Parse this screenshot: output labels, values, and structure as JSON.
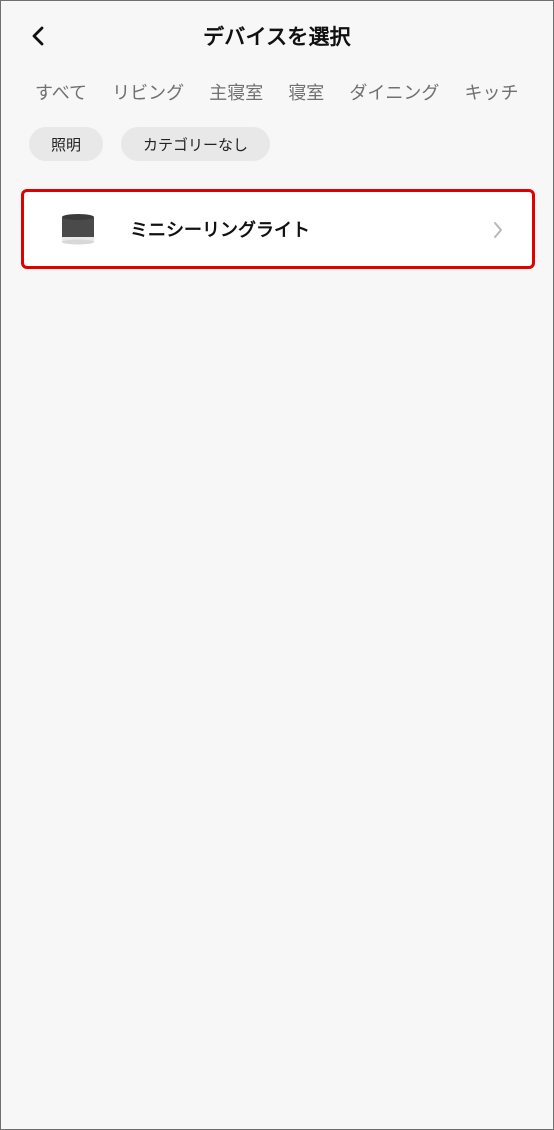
{
  "header": {
    "title": "デバイスを選択"
  },
  "room_tabs": [
    "すべて",
    "リビング",
    "主寝室",
    "寝室",
    "ダイニング",
    "キッチ"
  ],
  "category_chips": [
    "照明",
    "カテゴリーなし"
  ],
  "devices": [
    {
      "name": "ミニシーリングライト"
    }
  ],
  "colors": {
    "background": "#f7f7f7",
    "highlight": "#e00000",
    "chip": "#e8e8e8",
    "tab_text": "#707070"
  }
}
